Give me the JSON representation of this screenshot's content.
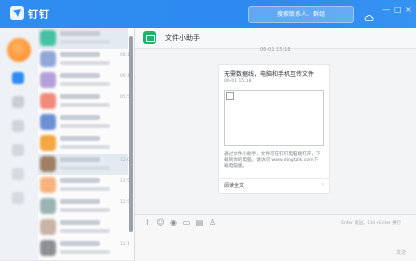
{
  "app": {
    "brand": "钉钉"
  },
  "search": {
    "placeholder": "搜索联系人、群组"
  },
  "window": {
    "minimize": "—",
    "maximize": "□",
    "close": "×"
  },
  "nav": {
    "icons": [
      "chat-icon",
      "contacts-icon",
      "work-icon",
      "ding-icon",
      "calendar-icon",
      "mail-icon"
    ]
  },
  "list": {
    "times": [
      "",
      "06:1",
      "06:1",
      "05:5",
      "",
      "",
      "12:0",
      "12:5",
      "12:5",
      "",
      "12:1"
    ],
    "avatar_colors": [
      "#45c2a2",
      "#8fa8d8",
      "#b5a0d8",
      "#f08b7c",
      "#6d8fd4",
      "#f4a640",
      "#9f8066",
      "#f8b37d",
      "#9cb3b3",
      "#c8b3a4",
      "#8d8f92"
    ]
  },
  "chat": {
    "title": "文件小助手",
    "message_time": "06-01 15:18",
    "card": {
      "title": "无需数据线，电脑和手机互传文件",
      "time": "06-01 15:18",
      "desc": "通过文件小助手，文件可在钉钉电脑端打开，下载到你的电脑。请访问 www.dingtalk.com下载电脑版。",
      "link": "阅读全文"
    },
    "composer": {
      "hint": "Enter 发送，Ctrl+Enter 换行",
      "send_label": "发送"
    }
  }
}
